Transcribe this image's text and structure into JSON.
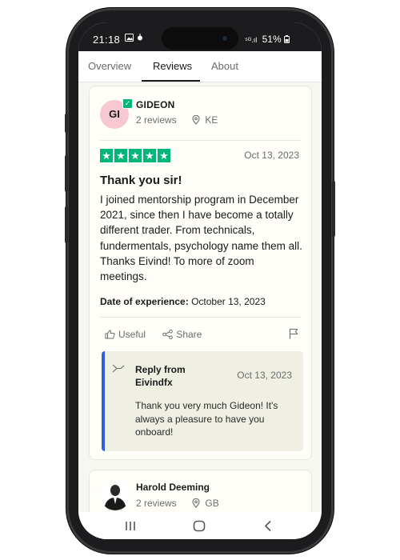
{
  "status": {
    "time": "21:18",
    "battery": "51%",
    "signal_text": "⁵ᴳ.ıl"
  },
  "tabs": [
    {
      "label": "Overview",
      "active": false
    },
    {
      "label": "Reviews",
      "active": true
    },
    {
      "label": "About",
      "active": false
    }
  ],
  "review": {
    "initials": "GI",
    "author": "GIDEON",
    "reviews_count": "2 reviews",
    "country": "KE",
    "rating": 5,
    "date": "Oct 13, 2023",
    "title": "Thank you sir!",
    "body": "I joined mentorship program in December 2021, since then I have become a totally different trader. From technicals, fundermentals, psychology name them all. Thanks Eivind! To more of zoom meetings.",
    "experience_label": "Date of experience:",
    "experience_date": "October 13, 2023",
    "useful_label": "Useful",
    "share_label": "Share",
    "reply": {
      "from": "Reply from Eivindfx",
      "date": "Oct 13, 2023",
      "text": "Thank you very much Gideon! It's always a pleasure to have you onboard!"
    }
  },
  "next_review": {
    "author": "Harold Deeming",
    "reviews_count": "2 reviews",
    "country": "GB"
  },
  "colors": {
    "star_green": "#00b67a",
    "reply_border": "#2f5fd9",
    "avatar_pink": "#f7c7d2"
  }
}
